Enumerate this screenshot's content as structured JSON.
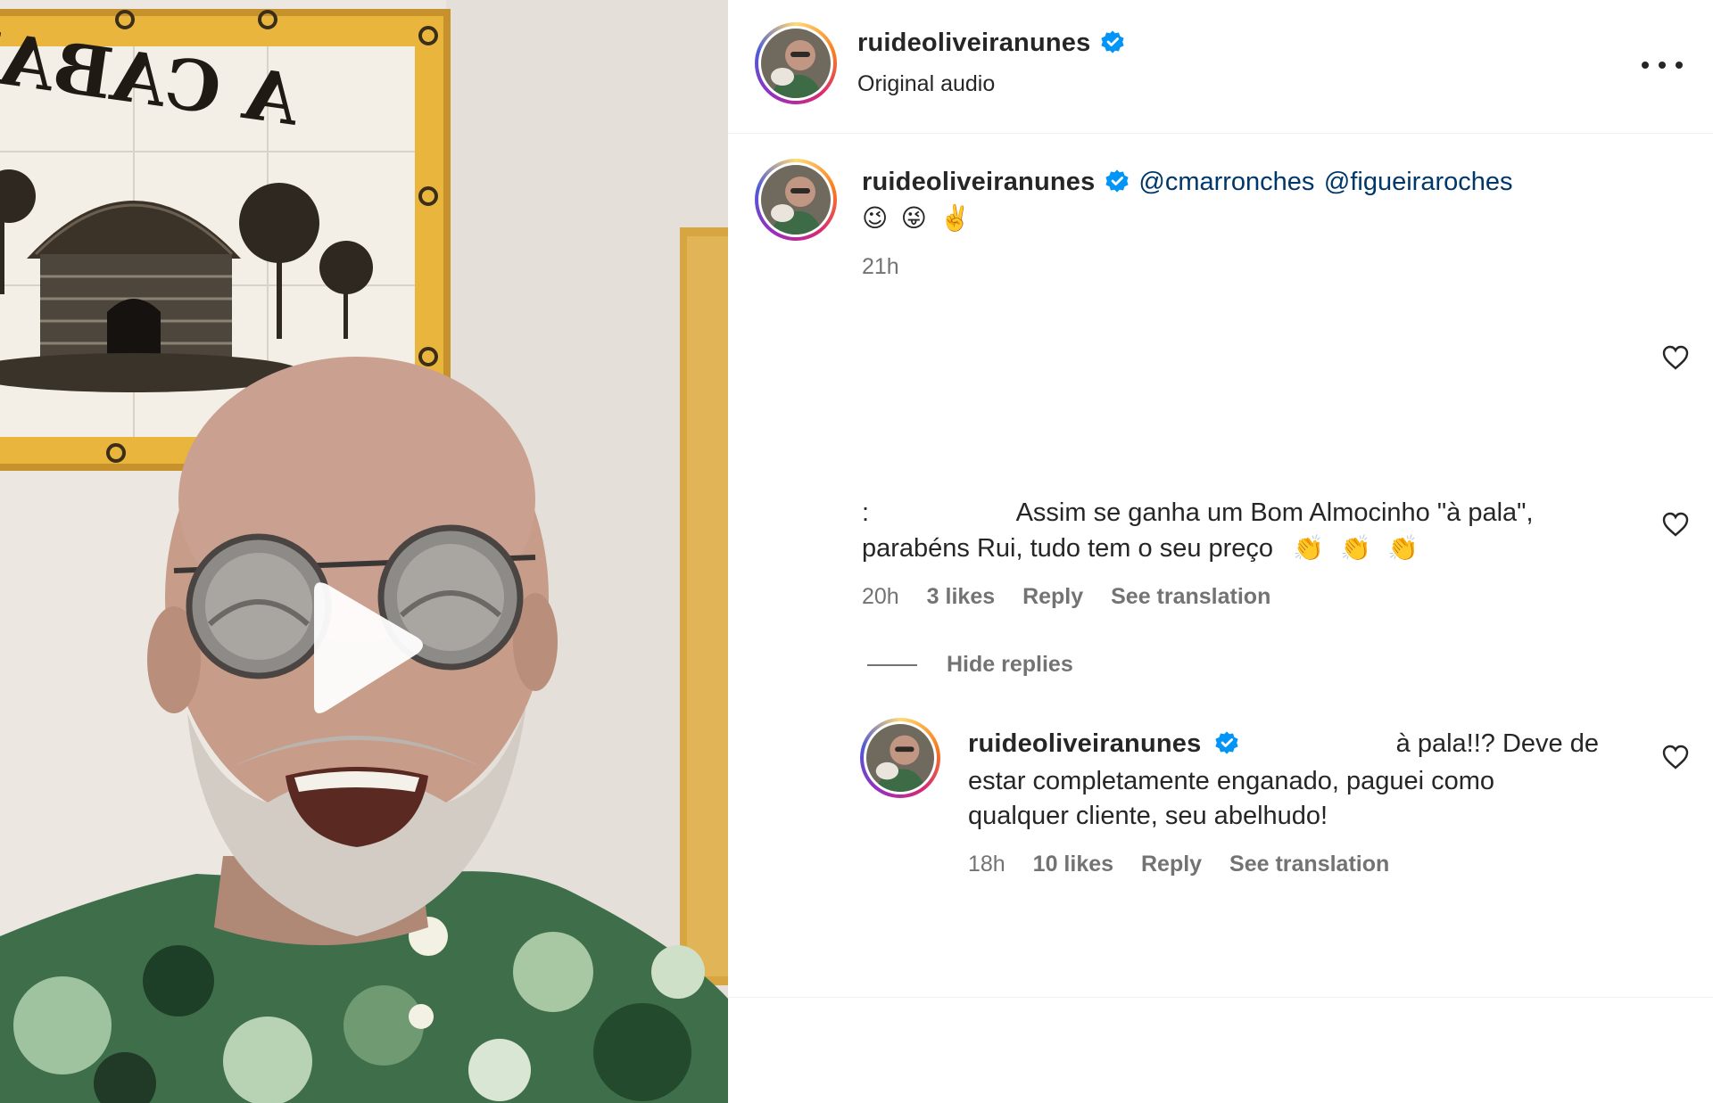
{
  "header": {
    "username": "ruideoliveiranunes",
    "subtitle": "Original audio"
  },
  "caption": {
    "username": "ruideoliveiranunes",
    "mention_1": "@cmarronches",
    "mention_2": "@figueiraroches",
    "emojis": [
      "😉",
      "😜",
      "✌️"
    ],
    "time": "21h"
  },
  "comment": {
    "prefix": ":",
    "line_1": "Assim se ganha um Bom Almocinho \"à pala\",",
    "line_2": "parabéns Rui, tudo tem o seu preço",
    "emojis": [
      "👏",
      "👏",
      "👏"
    ],
    "time": "20h",
    "likes": "3 likes",
    "reply": "Reply",
    "translate": "See translation",
    "hide_replies": "Hide replies"
  },
  "reply": {
    "username": "ruideoliveiranunes",
    "line_1": "à pala!!? Deve de",
    "line_2": "estar completamente enganado, paguei como",
    "line_3": "qualquer cliente, seu abelhudo!",
    "time": "18h",
    "likes": "10 likes",
    "reply": "Reply",
    "translate": "See translation"
  },
  "media": {
    "tile_text": "A CABANA"
  },
  "colors": {
    "verified": "#0095f6",
    "mention": "#00376b",
    "meta": "#737373"
  }
}
